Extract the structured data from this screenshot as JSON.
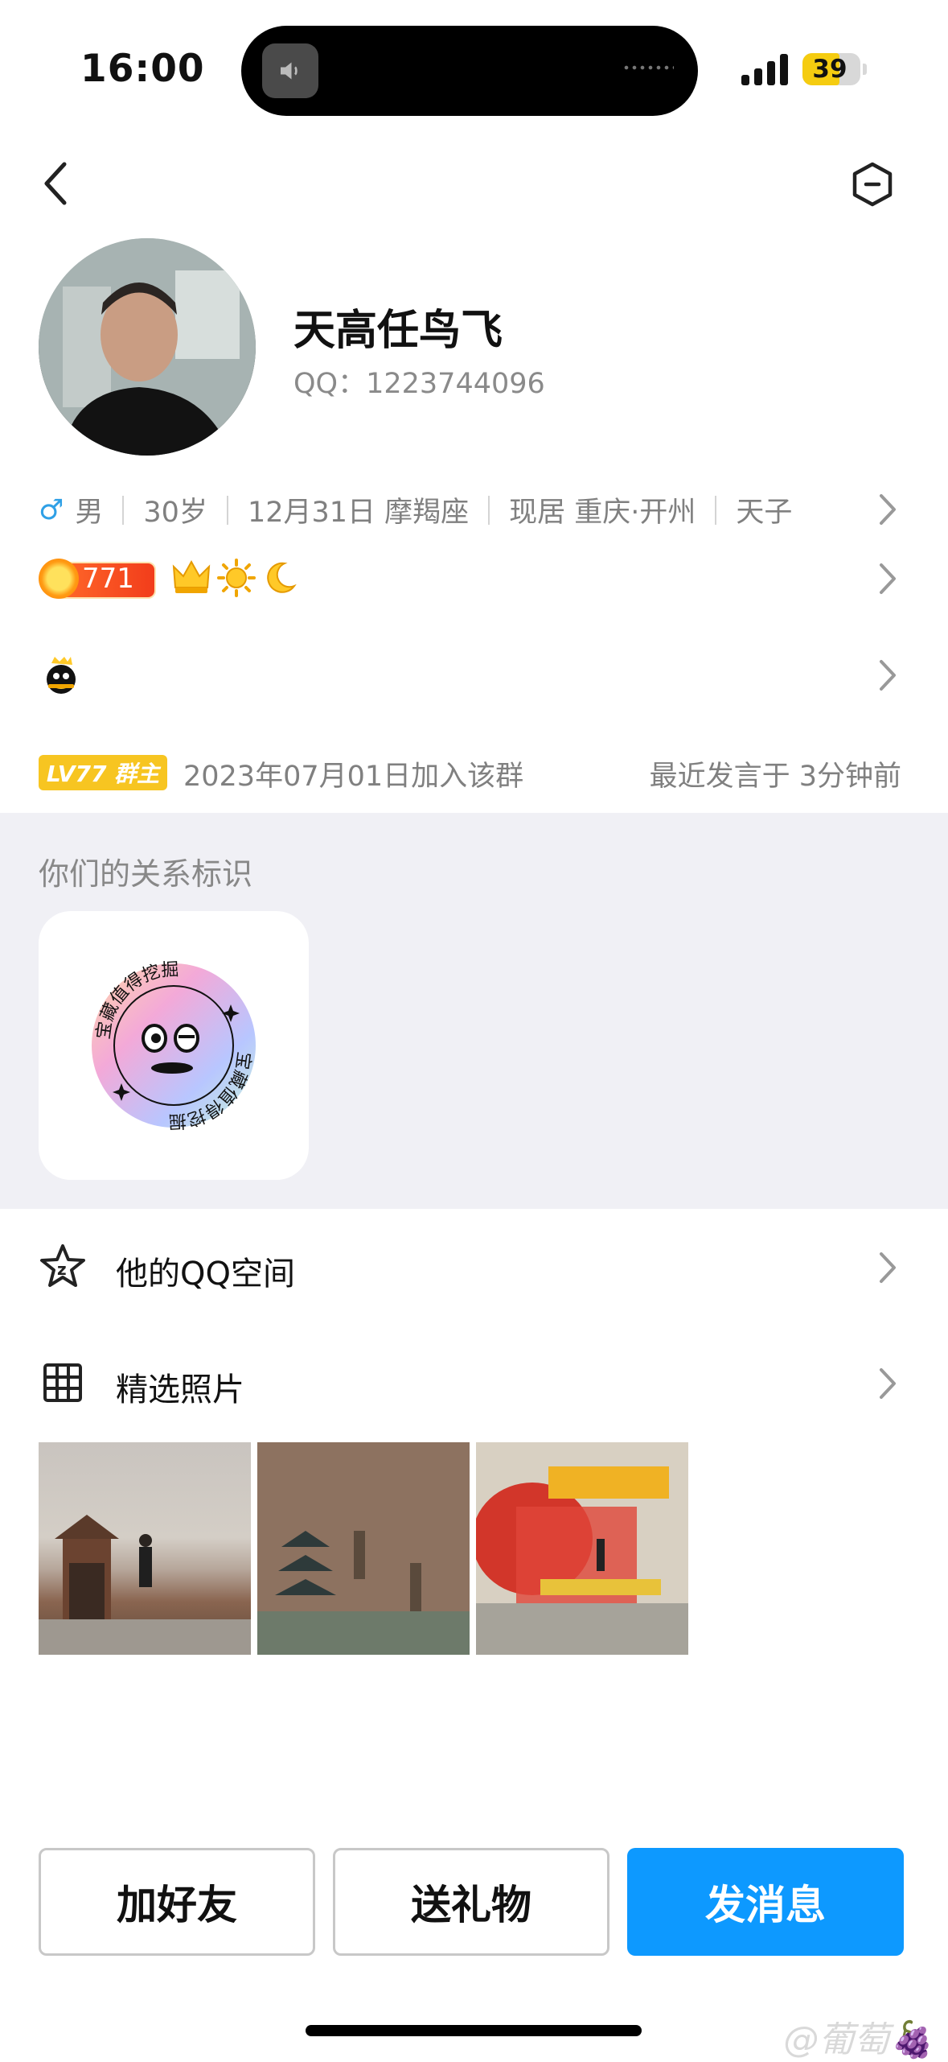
{
  "status_bar": {
    "time": "16:00",
    "battery": "39"
  },
  "profile": {
    "name": "天高任鸟飞",
    "qq_label": "QQ：",
    "qq_number": "1223744096"
  },
  "info": {
    "gender_symbol": "♂",
    "gender": "男",
    "age": "30岁",
    "birthday": "12月31日 摩羯座",
    "residence": "现居 重庆·开州",
    "extra": "天子"
  },
  "level": {
    "coin_count": "771"
  },
  "group": {
    "badge": "LV77 群主",
    "joined": "2023年07月01日加入该群",
    "last_active": "最近发言于 3分钟前"
  },
  "relation": {
    "title": "你们的关系标识",
    "badge_text": "宝藏值得挖掘"
  },
  "menu": {
    "qzone_label": "他的QQ空间",
    "photos_label": "精选照片"
  },
  "actions": {
    "add_friend": "加好友",
    "send_gift": "送礼物",
    "send_message": "发消息"
  },
  "watermark": "@葡萄🍇",
  "colors": {
    "primary_blue": "#0d99ff",
    "level_yellow": "#f7c521",
    "male_blue": "#2fa0e6"
  }
}
